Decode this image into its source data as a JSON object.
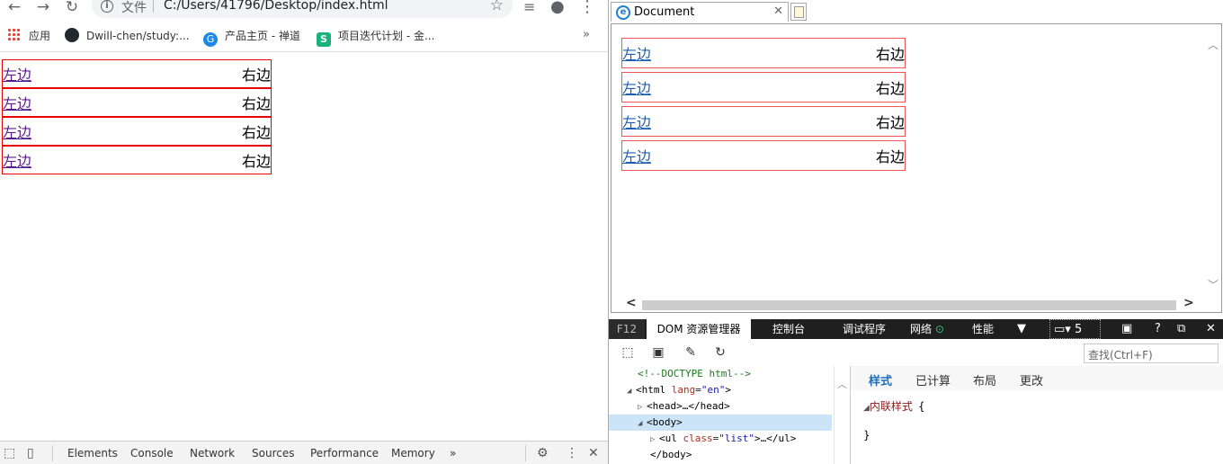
{
  "chrome": {
    "toolbar": {
      "back_icon": "arrow-left-icon",
      "forward_icon": "arrow-right-icon",
      "reload_icon": "reload-icon",
      "scheme_label": "文件",
      "url": "C:/Users/41796/Desktop/index.html"
    },
    "bookmarks": [
      {
        "label": "应用",
        "icon": "apps-grid-icon"
      },
      {
        "label": "Dwill-chen/study:...",
        "icon": "github-icon"
      },
      {
        "label": "产品主页 - 禅道",
        "icon": "zentao-icon"
      },
      {
        "label": "项目迭代计划 - 金...",
        "icon": "jinshuju-icon"
      }
    ],
    "bookmarks_more": "»",
    "list": [
      {
        "left": "左边",
        "right": "右边"
      },
      {
        "left": "左边",
        "right": "右边"
      },
      {
        "left": "左边",
        "right": "右边"
      },
      {
        "left": "左边",
        "right": "右边"
      }
    ],
    "devtools": {
      "tabs": [
        "Elements",
        "Console",
        "Network",
        "Sources",
        "Performance",
        "Memory"
      ],
      "more": "»"
    }
  },
  "ie": {
    "tab_title": "Document",
    "list": [
      {
        "left": "左边",
        "right": "右边"
      },
      {
        "left": "左边",
        "right": "右边"
      },
      {
        "left": "左边",
        "right": "右边"
      },
      {
        "left": "左边",
        "right": "右边"
      }
    ],
    "f12": {
      "label": "F12",
      "tabs": [
        "DOM 资源管理器",
        "控制台",
        "调试程序",
        "网络",
        "性能"
      ],
      "emulation_value": "5",
      "find_placeholder": "查找(Ctrl+F)"
    },
    "dom_tree": {
      "doctype": "<!--DOCTYPE html-->",
      "html_open": "<html ",
      "html_attr": "lang",
      "html_val": "\"en\"",
      "html_close": ">",
      "head": "<head>…</head>",
      "body": "<body>",
      "ul_open": "<ul ",
      "ul_attr": "class",
      "ul_val": "\"list\"",
      "ul_close": ">…</ul>",
      "body_close": "</body>"
    },
    "styles": {
      "tabs": [
        "样式",
        "已计算",
        "布局",
        "更改"
      ],
      "active_tab": "样式",
      "inline_label": "内联样式",
      "open_brace": "{",
      "close_brace": "}"
    }
  }
}
